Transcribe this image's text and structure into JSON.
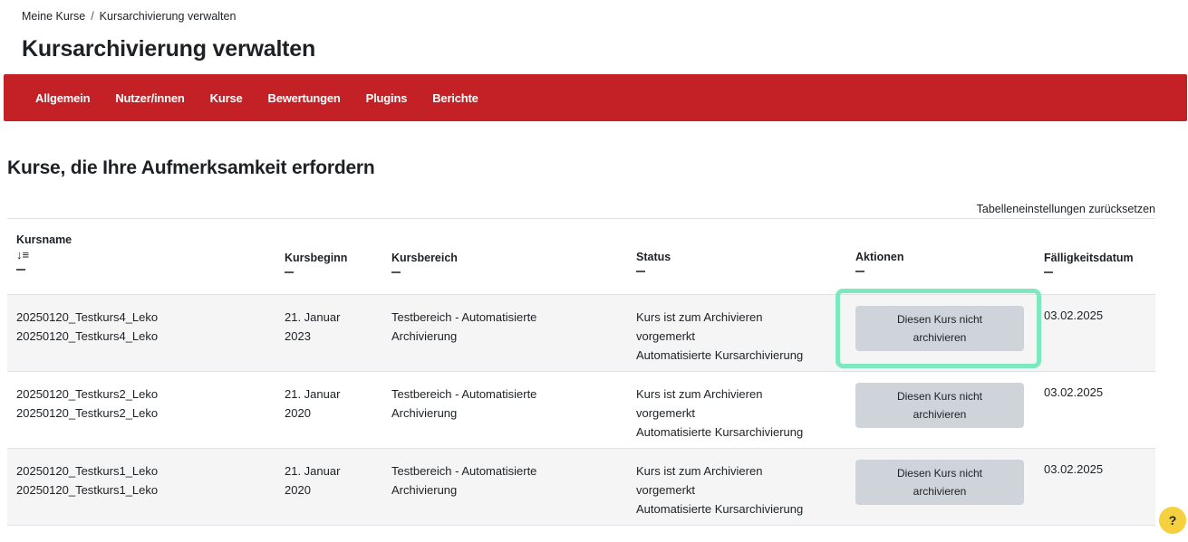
{
  "breadcrumb": {
    "items": [
      "Meine Kurse",
      "Kursarchivierung verwalten"
    ],
    "separator": "/"
  },
  "page_title": "Kursarchivierung verwalten",
  "nav": {
    "items": [
      "Allgemein",
      "Nutzer/innen",
      "Kurse",
      "Bewertungen",
      "Plugins",
      "Berichte"
    ],
    "color": "#c42126"
  },
  "section_title": "Kurse, die Ihre Aufmerksamkeit erfordern",
  "reset_link": "Tabelleneinstellungen zurücksetzen",
  "table": {
    "headers": {
      "name": "Kursname",
      "start": "Kursbeginn",
      "category": "Kursbereich",
      "status": "Status",
      "actions": "Aktionen",
      "due": "Fälligkeitsdatum"
    },
    "sort_icon": "↓≡",
    "rows": [
      {
        "name1": "20250120_Testkurs4_Leko",
        "name2": "20250120_Testkurs4_Leko",
        "start1": "21. Januar",
        "start2": "2023",
        "cat1": "Testbereich - Automatisierte",
        "cat2": "Archivierung",
        "status1": "Kurs ist zum Archivieren",
        "status2": "vorgemerkt",
        "status3": "Automatisierte Kursarchivierung",
        "action": "Diesen Kurs nicht archivieren",
        "due": "03.02.2025"
      },
      {
        "name1": "20250120_Testkurs2_Leko",
        "name2": "20250120_Testkurs2_Leko",
        "start1": "21. Januar",
        "start2": "2020",
        "cat1": "Testbereich - Automatisierte",
        "cat2": "Archivierung",
        "status1": "Kurs ist zum Archivieren",
        "status2": "vorgemerkt",
        "status3": "Automatisierte Kursarchivierung",
        "action": "Diesen Kurs nicht archivieren",
        "due": "03.02.2025"
      },
      {
        "name1": "20250120_Testkurs1_Leko",
        "name2": "20250120_Testkurs1_Leko",
        "start1": "21. Januar",
        "start2": "2020",
        "cat1": "Testbereich - Automatisierte",
        "cat2": "Archivierung",
        "status1": "Kurs ist zum Archivieren",
        "status2": "vorgemerkt",
        "status3": "Automatisierte Kursarchivierung",
        "action": "Diesen Kurs nicht archivieren",
        "due": "03.02.2025"
      }
    ]
  },
  "highlight_color": "#7ee8bf",
  "help_button": "?"
}
